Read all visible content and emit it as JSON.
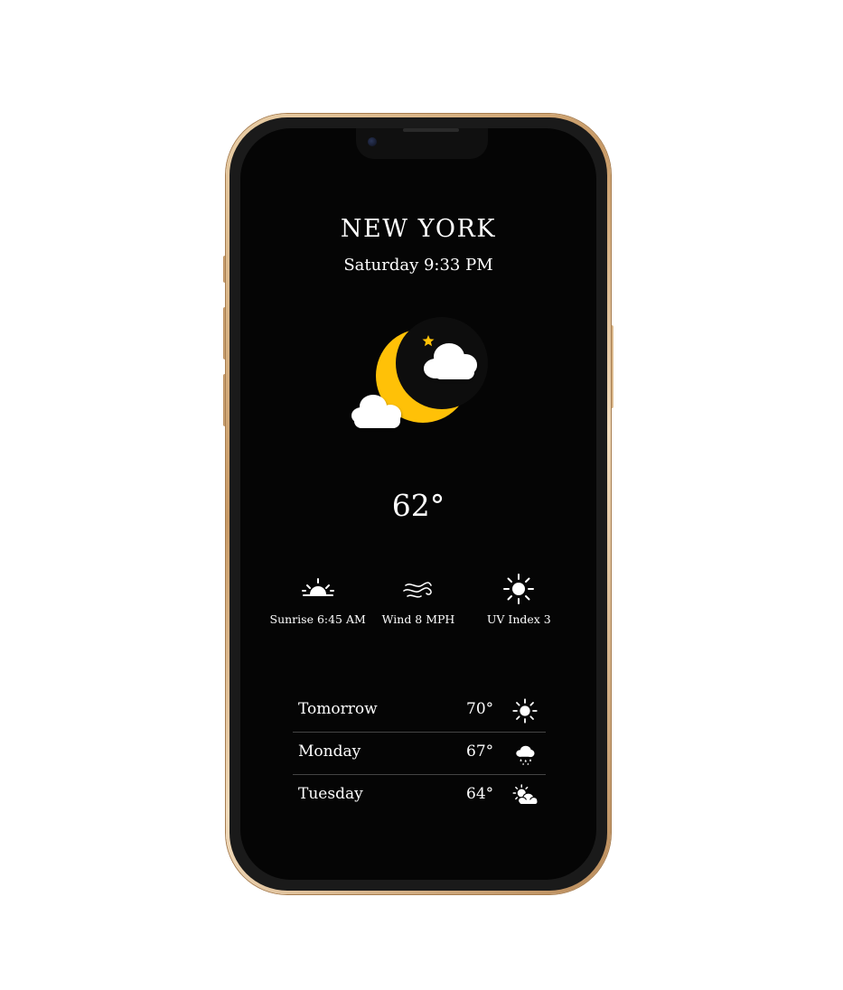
{
  "location": {
    "city": "NEW YORK",
    "datetime": "Saturday 9:33 PM"
  },
  "current": {
    "condition_icon": "moon-cloudy-icon",
    "temperature": "62°"
  },
  "stats": [
    {
      "icon": "sunrise-icon",
      "label": "Sunrise 6:45 AM"
    },
    {
      "icon": "wind-icon",
      "label": "Wind 8 MPH"
    },
    {
      "icon": "sun-icon",
      "label": "UV Index 3"
    }
  ],
  "forecast": [
    {
      "day": "Tomorrow",
      "temp": "70°",
      "icon": "sun-icon"
    },
    {
      "day": "Monday",
      "temp": "67°",
      "icon": "rain-cloud-icon"
    },
    {
      "day": "Tuesday",
      "temp": "64°",
      "icon": "partly-cloudy-icon"
    }
  ],
  "colors": {
    "screen_background": "#050505",
    "text": "#ffffff",
    "moon": "#ffc107",
    "frame_gold": "#d8b07c"
  }
}
